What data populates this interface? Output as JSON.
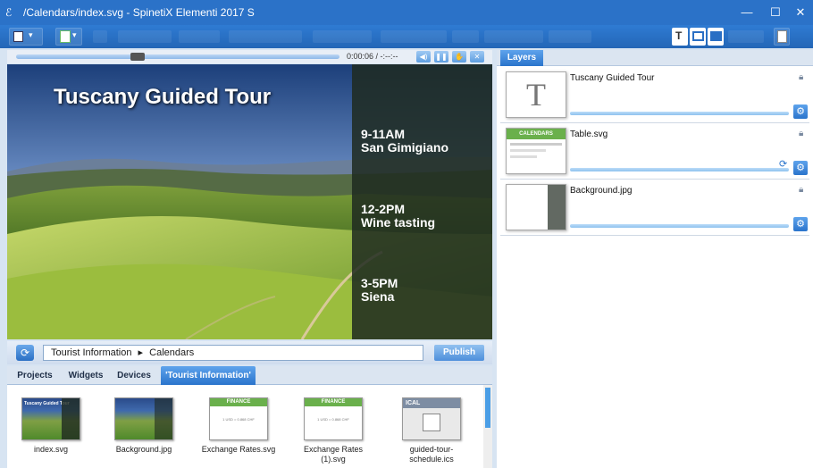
{
  "window": {
    "title": "/Calendars/index.svg - SpinetiX Elementi 2017 S",
    "minimize": "—",
    "maximize": "☐",
    "close": "✕"
  },
  "player": {
    "time": "0:00:06 / -:--:--"
  },
  "canvas": {
    "heading": "Tuscany Guided Tour",
    "events": [
      {
        "time": "9-11AM",
        "place": "San Gimigiano"
      },
      {
        "time": "12-2PM",
        "place": "Wine tasting"
      },
      {
        "time": "3-5PM",
        "place": "Siena"
      }
    ]
  },
  "address": {
    "segments": [
      "Tourist Information",
      "Calendars"
    ],
    "separator": "▸",
    "publish_label": "Publish"
  },
  "tabs": [
    {
      "label": "Projects"
    },
    {
      "label": "Widgets"
    },
    {
      "label": "Devices"
    },
    {
      "label": "'Tourist Information'",
      "active": true
    }
  ],
  "files": [
    {
      "name": "index.svg",
      "thumb_text": "Tuscany Guided Tour"
    },
    {
      "name": "Background.jpg"
    },
    {
      "name": "Exchange Rates.svg",
      "thumb_title": "FINANCE",
      "thumb_body": "1 USD = 0.868 CHF"
    },
    {
      "name": "Exchange Rates\n(1).svg",
      "thumb_title": "FINANCE",
      "thumb_body": "1 USD = 0.868 CHF"
    },
    {
      "name": "guided-tour-\nschedule.ics",
      "thumb_title": "ICAL"
    }
  ],
  "layers_panel": {
    "tab_label": "Layers",
    "layers": [
      {
        "name": "Tuscany Guided Tour",
        "thumb_text": "T"
      },
      {
        "name": "Table.svg",
        "thumb_title": "CALENDARS"
      },
      {
        "name": "Background.jpg"
      }
    ]
  },
  "colors": {
    "accent": "#2b72c8",
    "panel": "#dbe5f1",
    "finance": "#6ab04c"
  }
}
